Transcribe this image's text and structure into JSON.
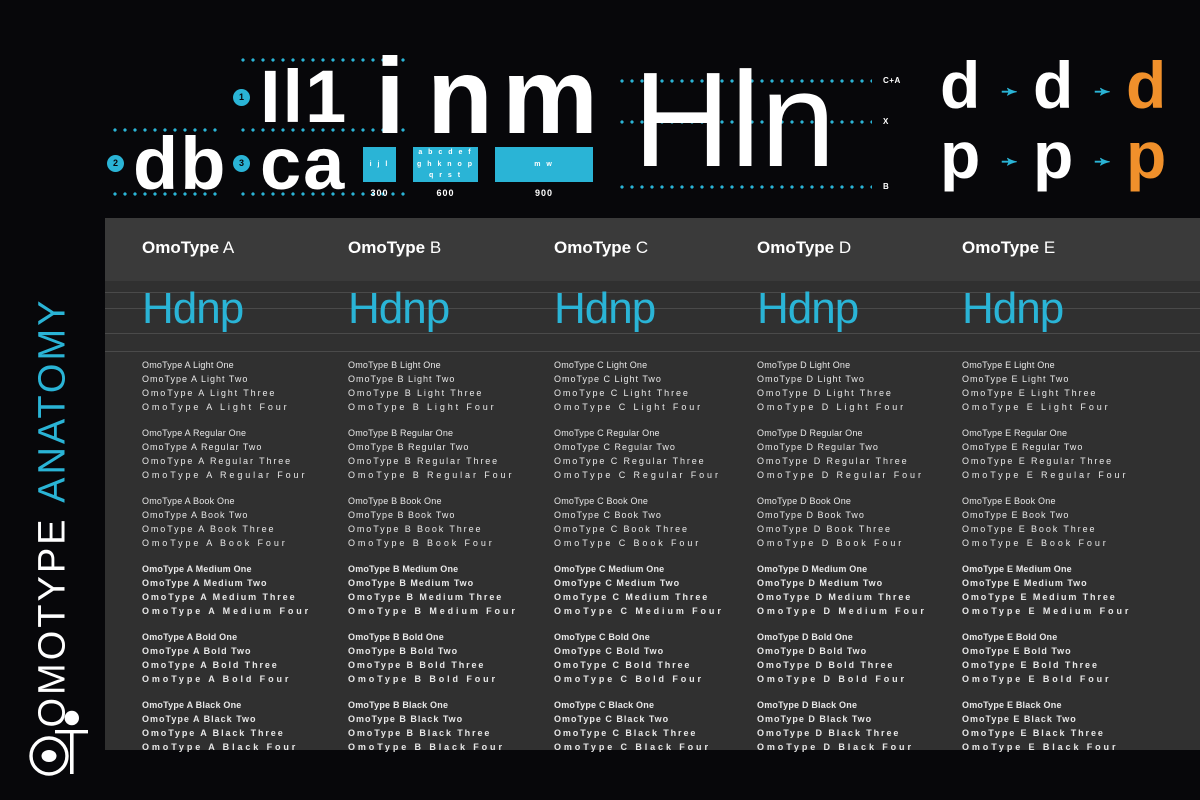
{
  "poster": {
    "vertical_title_primary": "OMOTYPE",
    "vertical_title_secondary": "ANATOMY",
    "logo_name": "omotype-logo-mark",
    "colors": {
      "background": "#07070a",
      "panel": "#303030",
      "panel_header": "#3a3a3a",
      "accent_cyan": "#2ab4d6",
      "accent_orange": "#f0902b",
      "text_white": "#ffffff"
    }
  },
  "anatomy": {
    "group_stems": {
      "badge": "1",
      "letters": "Il1"
    },
    "group_bowls": {
      "badge": "2",
      "letters": "db"
    },
    "group_curves": {
      "badge": "3",
      "letters": "ca"
    },
    "widths": {
      "letters": "i n m",
      "boxes": [
        {
          "glyph": "i",
          "contents": "i j l",
          "value": "300"
        },
        {
          "glyph": "n",
          "contents": "a b c d e f g h k n o p q r s t",
          "value": "600"
        },
        {
          "glyph": "m",
          "contents": "m w",
          "value": "900"
        }
      ]
    },
    "metrics": {
      "letters": "Hln",
      "labels": [
        {
          "key": "cap-ascender",
          "text": "C+A"
        },
        {
          "key": "x-height",
          "text": "X"
        },
        {
          "key": "baseline",
          "text": "B"
        }
      ]
    },
    "counters": {
      "arrow": "➛",
      "rows": [
        {
          "letter": "d",
          "steps": [
            "d",
            "d",
            "d"
          ]
        },
        {
          "letter": "p",
          "steps": [
            "p",
            "p",
            "p"
          ]
        }
      ]
    }
  },
  "specimen": {
    "preview_word": "Hdnp",
    "family_prefix": "OmoType",
    "columns": [
      {
        "id": "A",
        "title_bold": "OmoType",
        "title_light": "A",
        "preview": "Hdnp"
      },
      {
        "id": "B",
        "title_bold": "OmoType",
        "title_light": "B",
        "preview": "Hdnp"
      },
      {
        "id": "C",
        "title_bold": "OmoType",
        "title_light": "C",
        "preview": "Hdnp"
      },
      {
        "id": "D",
        "title_bold": "OmoType",
        "title_light": "D",
        "preview": "Hdnp"
      },
      {
        "id": "E",
        "title_bold": "OmoType",
        "title_light": "E",
        "preview": "Hdnp"
      }
    ],
    "weights": [
      "Light",
      "Regular",
      "Book",
      "Medium",
      "Bold",
      "Black"
    ],
    "steps": [
      "One",
      "Two",
      "Three",
      "Four"
    ],
    "lines": {
      "A": [
        [
          "OmoType A Light One",
          "OmoType A Light Two",
          "OmoType A Light Three",
          "OmoType A Light Four"
        ],
        [
          "OmoType A Regular One",
          "OmoType A Regular Two",
          "OmoType A Regular Three",
          "OmoType A Regular Four"
        ],
        [
          "OmoType A Book One",
          "OmoType A Book Two",
          "OmoType A Book Three",
          "OmoType A Book Four"
        ],
        [
          "OmoType A Medium One",
          "OmoType A Medium Two",
          "OmoType A Medium Three",
          "OmoType A Medium Four"
        ],
        [
          "OmoType A Bold One",
          "OmoType A Bold Two",
          "OmoType A Bold Three",
          "OmoType A Bold Four"
        ],
        [
          "OmoType A Black One",
          "OmoType A Black Two",
          "OmoType A Black Three",
          "OmoType A Black Four"
        ]
      ],
      "B": [
        [
          "OmoType B Light One",
          "OmoType B Light Two",
          "OmoType B Light Three",
          "OmoType B Light Four"
        ],
        [
          "OmoType B Regular One",
          "OmoType B Regular Two",
          "OmoType B Regular Three",
          "OmoType B Regular Four"
        ],
        [
          "OmoType B Book One",
          "OmoType B Book Two",
          "OmoType B Book Three",
          "OmoType B Book Four"
        ],
        [
          "OmoType B Medium One",
          "OmoType B Medium Two",
          "OmoType B Medium Three",
          "OmoType B Medium Four"
        ],
        [
          "OmoType B Bold One",
          "OmoType B Bold Two",
          "OmoType B Bold Three",
          "OmoType B Bold Four"
        ],
        [
          "OmoType B Black One",
          "OmoType B Black Two",
          "OmoType B Black Three",
          "OmoType B Black Four"
        ]
      ],
      "C": [
        [
          "OmoType C Light One",
          "OmoType C Light Two",
          "OmoType C Light Three",
          "OmoType C Light Four"
        ],
        [
          "OmoType C Regular One",
          "OmoType C Regular Two",
          "OmoType C Regular Three",
          "OmoType C Regular Four"
        ],
        [
          "OmoType C Book One",
          "OmoType C Book Two",
          "OmoType C Book Three",
          "OmoType C Book Four"
        ],
        [
          "OmoType C Medium One",
          "OmoType C Medium Two",
          "OmoType C Medium Three",
          "OmoType C Medium Four"
        ],
        [
          "OmoType C Bold One",
          "OmoType C Bold Two",
          "OmoType C Bold Three",
          "OmoType C Bold Four"
        ],
        [
          "OmoType C Black One",
          "OmoType C Black Two",
          "OmoType C Black Three",
          "OmoType C Black Four"
        ]
      ],
      "D": [
        [
          "OmoType D Light One",
          "OmoType D Light Two",
          "OmoType D Light Three",
          "OmoType D Light Four"
        ],
        [
          "OmoType D Regular One",
          "OmoType D Regular Two",
          "OmoType D Regular Three",
          "OmoType D Regular Four"
        ],
        [
          "OmoType D Book One",
          "OmoType D Book Two",
          "OmoType D Book Three",
          "OmoType D Book Four"
        ],
        [
          "OmoType D Medium One",
          "OmoType D Medium Two",
          "OmoType D Medium Three",
          "OmoType D Medium Four"
        ],
        [
          "OmoType D Bold One",
          "OmoType D Bold Two",
          "OmoType D Bold Three",
          "OmoType D Bold Four"
        ],
        [
          "OmoType D Black One",
          "OmoType D Black Two",
          "OmoType D Black Three",
          "OmoType D Black Four"
        ]
      ],
      "E": [
        [
          "OmoType E Light One",
          "OmoType E Light Two",
          "OmoType E Light Three",
          "OmoType E Light Four"
        ],
        [
          "OmoType E Regular One",
          "OmoType E Regular Two",
          "OmoType E Regular Three",
          "OmoType E Regular Four"
        ],
        [
          "OmoType E Book One",
          "OmoType E Book Two",
          "OmoType E Book Three",
          "OmoType E Book Four"
        ],
        [
          "OmoType E Medium One",
          "OmoType E Medium Two",
          "OmoType E Medium Three",
          "OmoType E Medium Four"
        ],
        [
          "OmoType E Bold One",
          "OmoType E Bold Two",
          "OmoType E Bold Three",
          "OmoType E Bold Four"
        ],
        [
          "OmoType E Black One",
          "OmoType E Black Two",
          "OmoType E Black Three",
          "OmoType E Black Four"
        ]
      ]
    }
  }
}
